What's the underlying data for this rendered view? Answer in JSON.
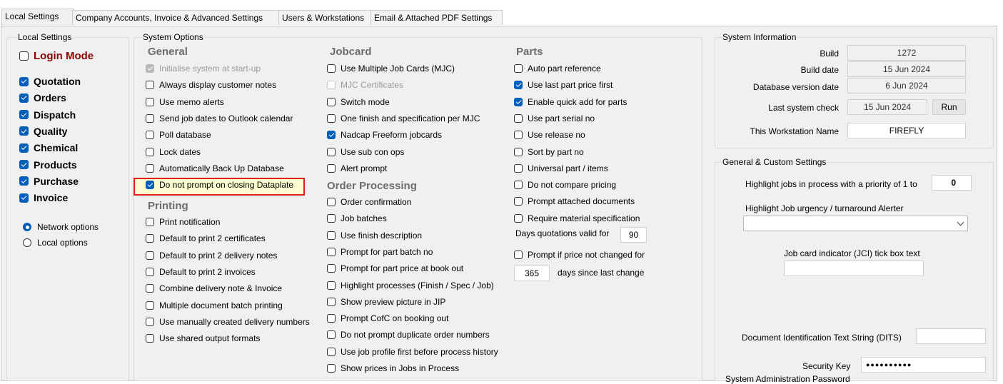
{
  "tabs": [
    "Local Settings",
    "Company Accounts, Invoice & Advanced Settings",
    "Users & Workstations",
    "Email & Attached PDF Settings"
  ],
  "local": {
    "legend": "Local Settings",
    "login_mode": "Login Mode",
    "modules": [
      "Quotation",
      "Orders",
      "Dispatch",
      "Quality",
      "Chemical",
      "Products",
      "Purchase",
      "Invoice"
    ],
    "radios": [
      "Network options",
      "Local options"
    ]
  },
  "system": {
    "legend": "System Options",
    "general": {
      "title": "General",
      "items": [
        "Initialise system at start-up",
        "Always display customer notes",
        "Use memo alerts",
        "Send job dates to Outlook calendar",
        "Poll database",
        "Lock dates",
        "Automatically Back Up Database",
        "Do not prompt on closing Dataplate"
      ]
    },
    "printing": {
      "title": "Printing",
      "items": [
        "Print notification",
        "Default to print 2 certificates",
        "Default to print 2 delivery notes",
        "Default to print 2 invoices",
        "Combine delivery note & Invoice",
        "Multiple document batch printing",
        "Use manually created delivery numbers",
        "Use shared output formats"
      ]
    },
    "jobcard": {
      "title": "Jobcard",
      "items": [
        "Use Multiple Job Cards (MJC)",
        "MJC Certificates",
        "Switch mode",
        "One finish and specification per MJC",
        "Nadcap Freeform jobcards",
        "Use sub con ops",
        "Alert prompt"
      ]
    },
    "order": {
      "title": "Order Processing",
      "items": [
        "Order confirmation",
        "Job batches",
        "Use finish description",
        "Prompt for part batch no",
        "Prompt for part price at book out",
        "Highlight processes (Finish / Spec / Job)",
        "Show preview picture in JIP",
        "Prompt CofC on booking out",
        "Do not prompt duplicate order numbers",
        "Use job profile first before process history",
        "Show prices in Jobs in Process"
      ]
    },
    "parts": {
      "title": "Parts",
      "items": [
        "Auto part reference",
        "Use last part price first",
        "Enable quick add for parts",
        "Use part serial no",
        "Use release no",
        "Sort by part no",
        "Universal part / items",
        "Do not compare pricing",
        "Prompt attached documents",
        "Require material specification"
      ],
      "days_valid_label": "Days quotations valid for",
      "days_valid_value": "90",
      "prompt_price": "Prompt if price not changed for",
      "days_since_value": "365",
      "days_since_label": "days since last change"
    }
  },
  "sysinfo": {
    "legend": "System Information",
    "build_label": "Build",
    "build": "1272",
    "build_date_label": "Build date",
    "build_date": "15 Jun 2024",
    "db_date_label": "Database version date",
    "db_date": "6 Jun 2024",
    "last_check_label": "Last system check",
    "last_check": "15 Jun 2024",
    "run": "Run",
    "ws_label": "This Workstation Name",
    "ws": "FIREFLY"
  },
  "custom": {
    "legend": "General & Custom Settings",
    "priority_label": "Highlight jobs in process with a priority of 1 to",
    "priority_value": "0",
    "urgency_label": "Highlight Job urgency / turnaround Alerter",
    "jci_label": "Job card indicator (JCI) tick box text",
    "dits_label": "Document Identification Text String (DITS)",
    "security_label": "Security Key",
    "security_value": "●●●●●●●●●●",
    "admin_label": "System Administration Password"
  }
}
